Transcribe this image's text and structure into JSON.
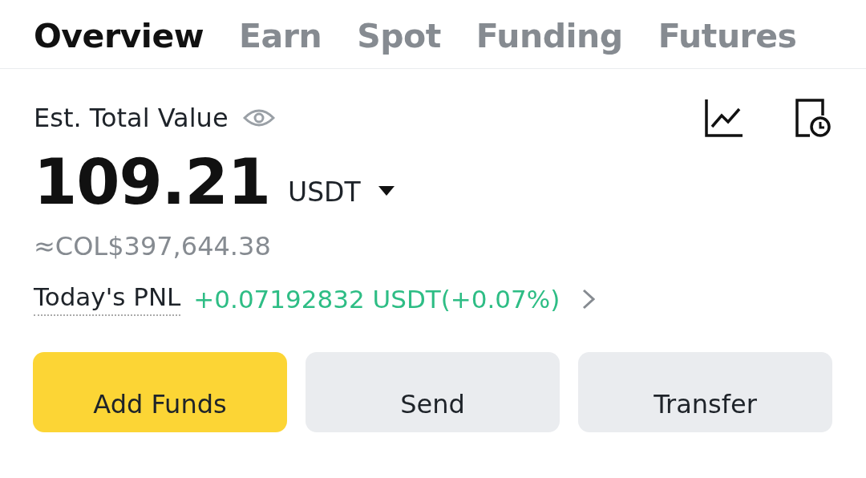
{
  "tabs": [
    {
      "label": "Overview",
      "selected": true
    },
    {
      "label": "Earn",
      "selected": false
    },
    {
      "label": "Spot",
      "selected": false
    },
    {
      "label": "Funding",
      "selected": false
    },
    {
      "label": "Futures",
      "selected": false
    }
  ],
  "total": {
    "label": "Est. Total Value",
    "amount": "109.21",
    "currency": "USDT"
  },
  "fiat": "≈COL$397,644.38",
  "pnl": {
    "label": "Today's PNL",
    "value": "+0.07192832 USDT(+0.07%)"
  },
  "buttons": [
    {
      "label": "Add Funds",
      "kind": "primary"
    },
    {
      "label": "Send",
      "kind": "secondary"
    },
    {
      "label": "Transfer",
      "kind": "secondary"
    }
  ]
}
